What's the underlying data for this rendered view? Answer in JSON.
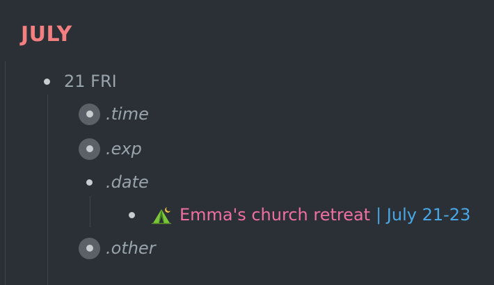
{
  "month": {
    "title": "JULY"
  },
  "outline": {
    "day": {
      "label": "21 FRI",
      "children": [
        {
          "label": ".time",
          "collapsed": true
        },
        {
          "label": ".exp",
          "collapsed": true
        },
        {
          "label": ".date",
          "collapsed": false,
          "children": [
            {
              "icon": "tent-camping-icon",
              "title": "Emma's church retreat",
              "separator_and_date": "| July 21-23"
            }
          ]
        },
        {
          "label": ".other",
          "collapsed": true
        }
      ]
    }
  },
  "colors": {
    "background": "#2a3035",
    "heading": "#f47f81",
    "event_title": "#f06fa3",
    "event_date": "#4aa7e6",
    "muted_text": "#9aa4ad"
  }
}
